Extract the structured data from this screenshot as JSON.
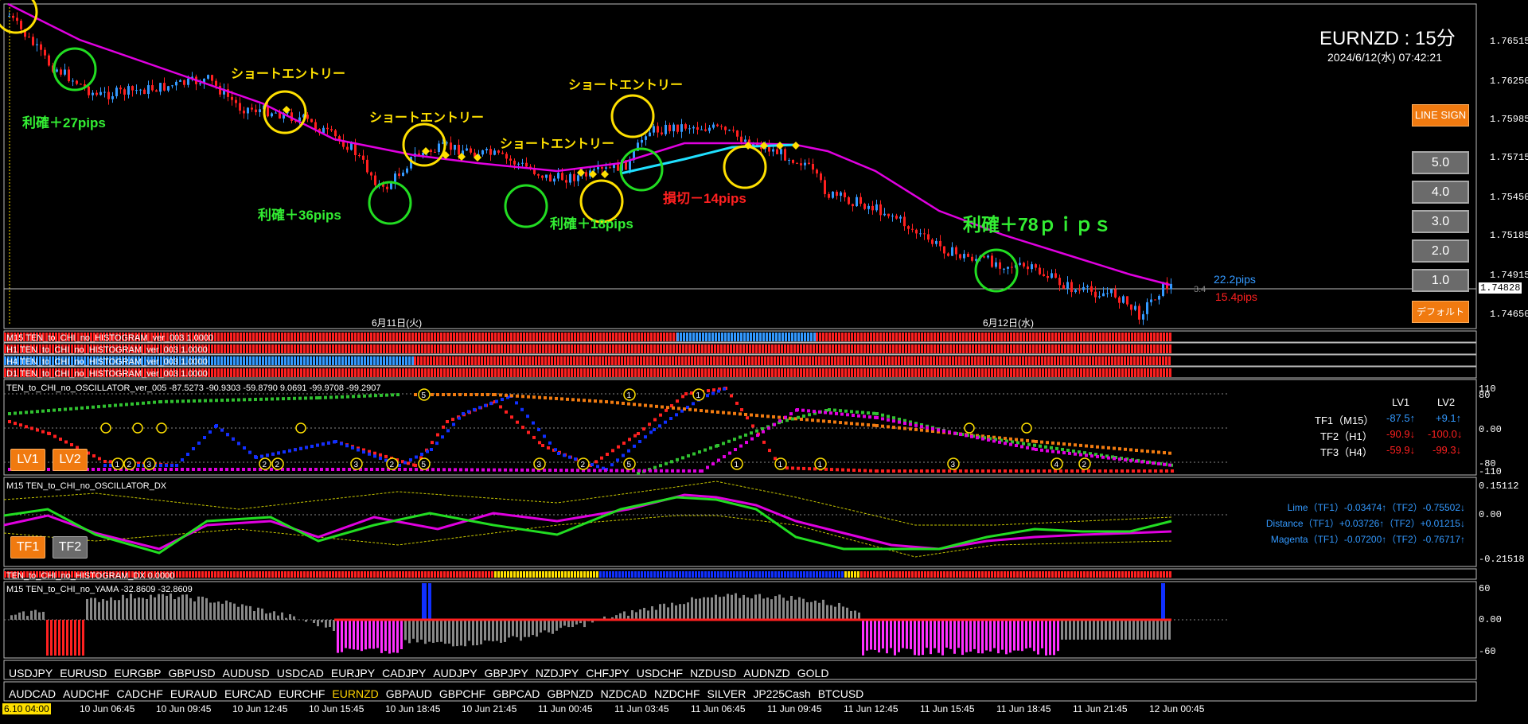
{
  "header": {
    "symbol_title": "EURNZD : 15分",
    "datetime": "2024/6/12(水) 07:42:21"
  },
  "side_buttons": {
    "line_sign": "LINE SIGN",
    "levels": [
      "5.0",
      "4.0",
      "3.0",
      "2.0",
      "1.0"
    ],
    "default": "デフォルト"
  },
  "price_scale": [
    "1.76515",
    "1.76250",
    "1.75985",
    "1.75715",
    "1.75450",
    "1.75185",
    "1.74915",
    "1.74650"
  ],
  "current_price": "1.74828",
  "pips_display": {
    "upper": "22.2pips",
    "lower": "15.4pips",
    "small": "3.4"
  },
  "date_separators": [
    "6月11日(火)",
    "6月12日(水)"
  ],
  "annotations": {
    "short_entry": "ショートエントリー",
    "profit_27": "利確＋27pips",
    "profit_36": "利確＋36pips",
    "profit_18": "利確＋18pips",
    "loss_14": "損切－14pips",
    "profit_78": "利確＋78ｐｉｐｓ"
  },
  "histogram_labels": [
    "M15 TEN_to_CHI_no_HISTOGRAM_ver_003 1.0000",
    "H1 TEN_to_CHI_no_HISTOGRAM_ver_003 1.0000",
    "H4 TEN_to_CHI_no_HISTOGRAM_ver_003 1.0000",
    "D1 TEN_to_CHI_no_HISTOGRAM_ver_003 1.0000"
  ],
  "oscillator": {
    "label": "TEN_to_CHI_no_OSCILLATOR_ver_005 -87.5273 -90.9303 -59.8790 9.0691 -99.9708 -99.2907",
    "scale": [
      "110",
      "80",
      "0.00",
      "-80",
      "-110"
    ],
    "buttons": [
      "LV1",
      "LV2"
    ],
    "table_header": [
      "LV1",
      "LV2"
    ],
    "rows": [
      {
        "name": "TF1（M15）",
        "lv1": "-87.5↑",
        "lv2": "+9.1↑"
      },
      {
        "name": "TF2（H1）",
        "lv1": "-90.9↓",
        "lv2": "-100.0↓"
      },
      {
        "name": "TF3（H4）",
        "lv1": "-59.9↓",
        "lv2": "-99.3↓"
      }
    ],
    "marker_nums": [
      "1",
      "2",
      "3",
      "4",
      "5"
    ]
  },
  "dx": {
    "label": "M15 TEN_to_CHI_no_OSCILLATOR_DX",
    "scale": [
      "0.15112",
      "0.00",
      "-0.21518"
    ],
    "buttons": [
      "TF1",
      "TF2"
    ],
    "rows": [
      "Lime（TF1）-0.03474↑（TF2）-0.75502↓",
      "Distance（TF1）+0.03726↑（TF2）+0.01215↓",
      "Magenta（TF1）-0.07200↑（TF2）-0.76717↑"
    ]
  },
  "hist_dx_label": "TEN_to_CHI_no_HISTOGRAM_DX 0.0000",
  "yama": {
    "label": "M15  TEN_to_CHI_no_YAMA  -32.8609 -32.8609",
    "scale": [
      "60",
      "0.00",
      "-60"
    ]
  },
  "symbols_row1": [
    "USDJPY",
    "EURUSD",
    "EURGBP",
    "GBPUSD",
    "AUDUSD",
    "USDCAD",
    "EURJPY",
    "CADJPY",
    "AUDJPY",
    "GBPJPY",
    "NZDJPY",
    "CHFJPY",
    "USDCHF",
    "NZDUSD",
    "AUDNZD",
    "GOLD"
  ],
  "symbols_row2": [
    "AUDCAD",
    "AUDCHF",
    "CADCHF",
    "EURAUD",
    "EURCAD",
    "EURCHF",
    "EURNZD",
    "GBPAUD",
    "GBPCHF",
    "GBPCAD",
    "GBPNZD",
    "NZDCAD",
    "NZDCHF",
    "SILVER",
    "JP225Cash",
    "BTCUSD"
  ],
  "active_symbol": "EURNZD",
  "time_axis": [
    "6.10 04:00",
    "10 Jun 06:45",
    "10 Jun 09:45",
    "10 Jun 12:45",
    "10 Jun 15:45",
    "10 Jun 18:45",
    "10 Jun 21:45",
    "11 Jun 00:45",
    "11 Jun 03:45",
    "11 Jun 06:45",
    "11 Jun 09:45",
    "11 Jun 12:45",
    "11 Jun 15:45",
    "11 Jun 18:45",
    "11 Jun 21:45",
    "12 Jun 00:45"
  ],
  "colors": {
    "bull": "#3399ff",
    "bear": "#ff2020",
    "ma": "#e000e0",
    "cyan": "#20e0ff",
    "green": "#22dd22",
    "yellow": "#ffe000",
    "orange": "#f07a10"
  }
}
